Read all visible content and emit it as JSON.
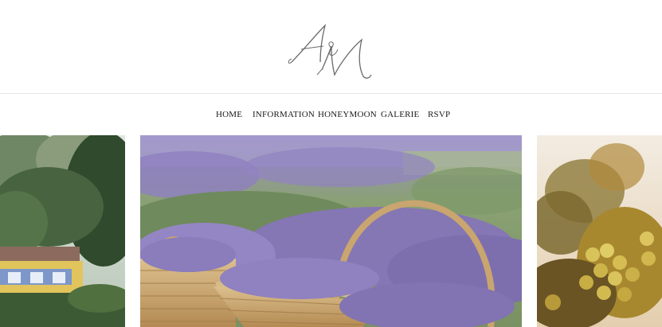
{
  "header": {
    "logo_text": "A&M",
    "logo_icon": "monogram-logo"
  },
  "nav": {
    "items": [
      {
        "label": "HOME"
      },
      {
        "label": "INFORMATION"
      },
      {
        "label": "HONEYMOON"
      },
      {
        "label": "GALERIE"
      },
      {
        "label": "RSVP"
      }
    ]
  },
  "slider": {
    "slides": [
      {
        "subject": "garden-villa-photo"
      },
      {
        "subject": "lavender-baskets-photo"
      },
      {
        "subject": "grape-vine-photo"
      }
    ]
  },
  "colors": {
    "logo": "#6a6a6a",
    "nav_text": "#1a1a1a",
    "divider": "#e6e6e6",
    "lavender": "#8a7bb8",
    "wicker": "#c9a56f"
  }
}
